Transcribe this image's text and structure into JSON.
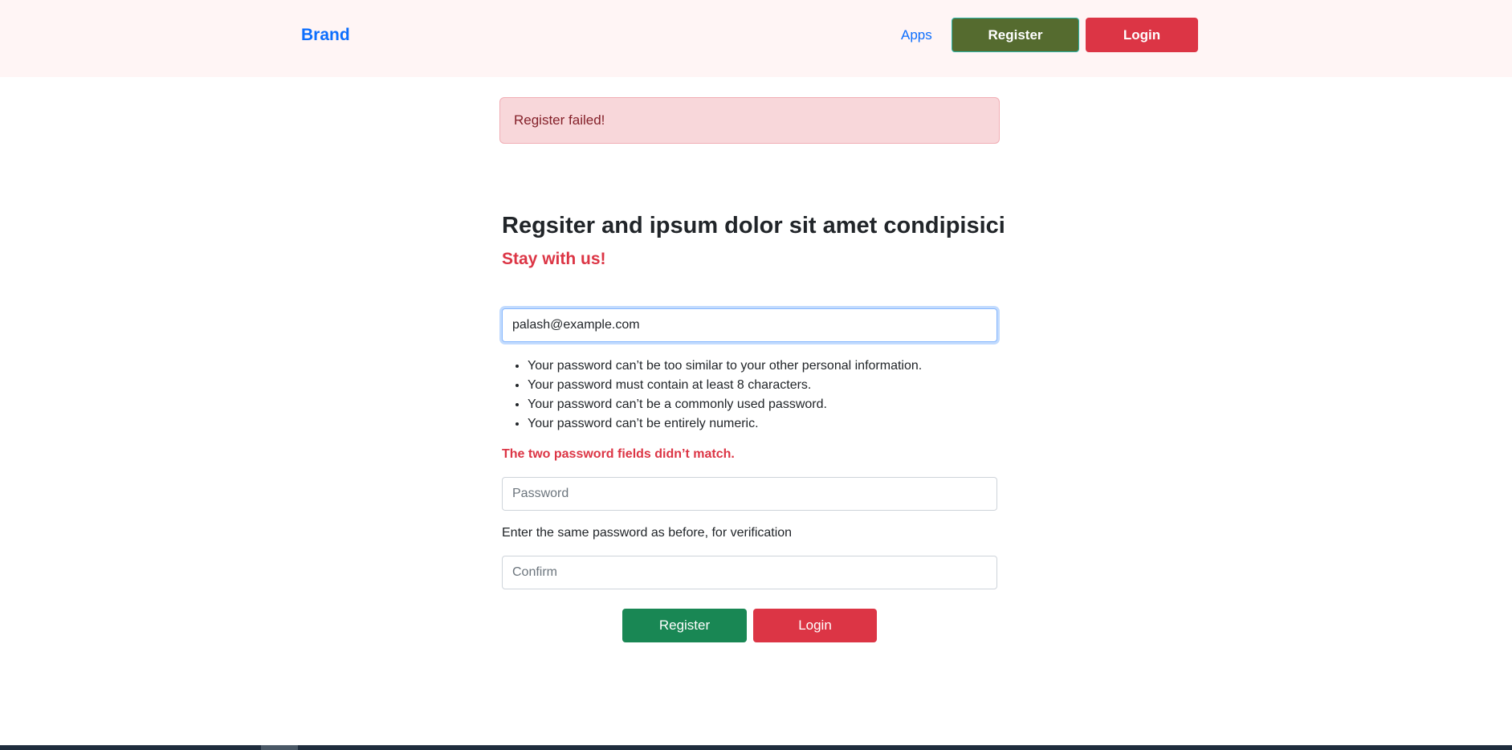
{
  "navbar": {
    "brand": "Brand",
    "apps_link": "Apps",
    "register_button": "Register",
    "login_button": "Login"
  },
  "alert": {
    "message": "Register failed!"
  },
  "form": {
    "title": "Regsiter and ipsum dolor sit amet condipisici",
    "subtitle": "Stay with us!",
    "email_value": "palash@example.com",
    "password_rules": [
      "Your password can’t be too similar to your other personal information.",
      "Your password must contain at least 8 characters.",
      "Your password can’t be a commonly used password.",
      "Your password can’t be entirely numeric."
    ],
    "match_error": "The two password fields didn’t match.",
    "password_placeholder": "Password",
    "confirm_help": "Enter the same password as before, for verification",
    "confirm_placeholder": "Confirm",
    "register_button": "Register",
    "login_button": "Login"
  },
  "colors": {
    "brand": "#0d6efd",
    "danger": "#dc3545",
    "success": "#198754",
    "nav_register": "#556b2f"
  }
}
